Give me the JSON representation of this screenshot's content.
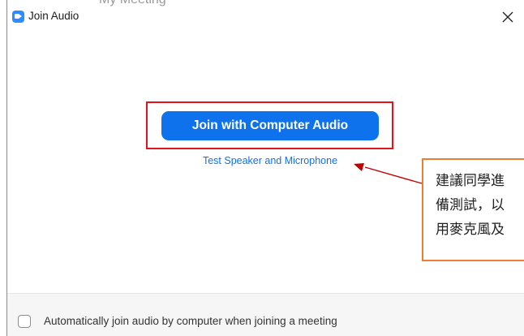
{
  "background_window": {
    "title_fragment": "My Meeting"
  },
  "window": {
    "title": "Join Audio",
    "app_icon": "zoom-camera-icon",
    "close_icon": "close-icon"
  },
  "main": {
    "join_button_label": "Join with Computer Audio",
    "test_link_label": "Test Speaker and Microphone"
  },
  "annotation": {
    "lines": [
      "建議同學進",
      "備測試，以",
      "用麥克風及"
    ],
    "border_color": "#ed7d31",
    "highlight_color": "#e3131a",
    "arrow_color": "#c00000"
  },
  "footer": {
    "auto_join_checked": false,
    "auto_join_label": "Automatically join audio by computer when joining a meeting"
  },
  "colors": {
    "accent": "#0e72ed",
    "link": "#0e71eb",
    "zoom_blue": "#2d8cff"
  }
}
